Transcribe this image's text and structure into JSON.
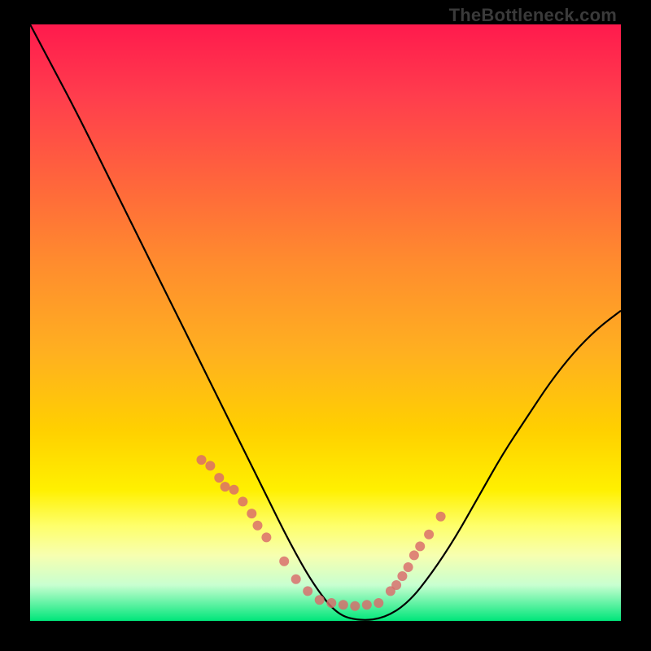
{
  "watermark": "TheBottleneck.com",
  "chart_data": {
    "type": "line",
    "title": "",
    "xlabel": "",
    "ylabel": "",
    "xlim": [
      0,
      100
    ],
    "ylim": [
      0,
      100
    ],
    "grid": false,
    "legend": false,
    "series": [
      {
        "name": "curve",
        "color": "#000000",
        "x": [
          0,
          4,
          8,
          12,
          16,
          20,
          24,
          28,
          32,
          36,
          40,
          44,
          48,
          52,
          56,
          60,
          64,
          68,
          72,
          76,
          80,
          84,
          88,
          92,
          96,
          100
        ],
        "y": [
          100,
          92.5,
          85,
          77,
          69,
          61,
          53,
          45,
          37,
          29,
          21,
          13,
          6,
          1,
          0,
          0.5,
          3,
          8,
          14,
          21,
          28,
          34,
          40,
          45,
          49,
          52
        ]
      }
    ],
    "markers": {
      "name": "highlight-points",
      "color": "#d96a6a",
      "radius_px": 6,
      "x": [
        29,
        30.5,
        32,
        33,
        34.5,
        36,
        37.5,
        38.5,
        40,
        43,
        45,
        47,
        49,
        51,
        53,
        55,
        57,
        59,
        61,
        62,
        63,
        64,
        65,
        66,
        67.5,
        69.5
      ],
      "y": [
        27,
        26,
        24,
        22.5,
        22,
        20,
        18,
        16,
        14,
        10,
        7,
        5,
        3.5,
        3,
        2.7,
        2.5,
        2.7,
        3,
        5,
        6,
        7.5,
        9,
        11,
        12.5,
        14.5,
        17.5
      ]
    }
  }
}
